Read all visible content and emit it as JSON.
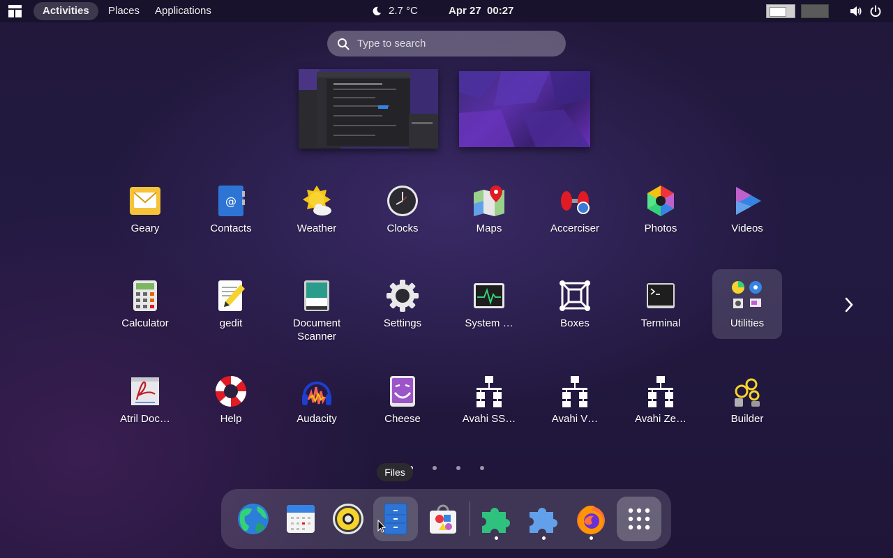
{
  "topbar": {
    "activities": "Activities",
    "places": "Places",
    "applications": "Applications",
    "weather_icon": "moon-icon",
    "temperature": "2.7 °C",
    "clock": "Apr 27  00:27"
  },
  "search": {
    "placeholder": "Type to search",
    "value": ""
  },
  "apps": [
    {
      "label": "Geary"
    },
    {
      "label": "Contacts"
    },
    {
      "label": "Weather"
    },
    {
      "label": "Clocks"
    },
    {
      "label": "Maps"
    },
    {
      "label": "Accerciser"
    },
    {
      "label": "Photos"
    },
    {
      "label": "Videos"
    },
    {
      "label": "Calculator"
    },
    {
      "label": "gedit"
    },
    {
      "label": "Document Scanner"
    },
    {
      "label": "Settings"
    },
    {
      "label": "System …"
    },
    {
      "label": "Boxes"
    },
    {
      "label": "Terminal"
    },
    {
      "label": "Utilities"
    },
    {
      "label": "Atril Doc…"
    },
    {
      "label": "Help"
    },
    {
      "label": "Audacity"
    },
    {
      "label": "Cheese"
    },
    {
      "label": "Avahi SS…"
    },
    {
      "label": "Avahi V…"
    },
    {
      "label": "Avahi Ze…"
    },
    {
      "label": "Builder"
    }
  ],
  "tooltip": "Files",
  "dash": [
    "Web",
    "Calendar",
    "Rhythmbox",
    "Files",
    "Software",
    "Extensions",
    "Extension Manager",
    "Firefox",
    "Show Apps"
  ],
  "colors": {
    "accent": "#3584e4",
    "panel": "#2b2b2f"
  }
}
